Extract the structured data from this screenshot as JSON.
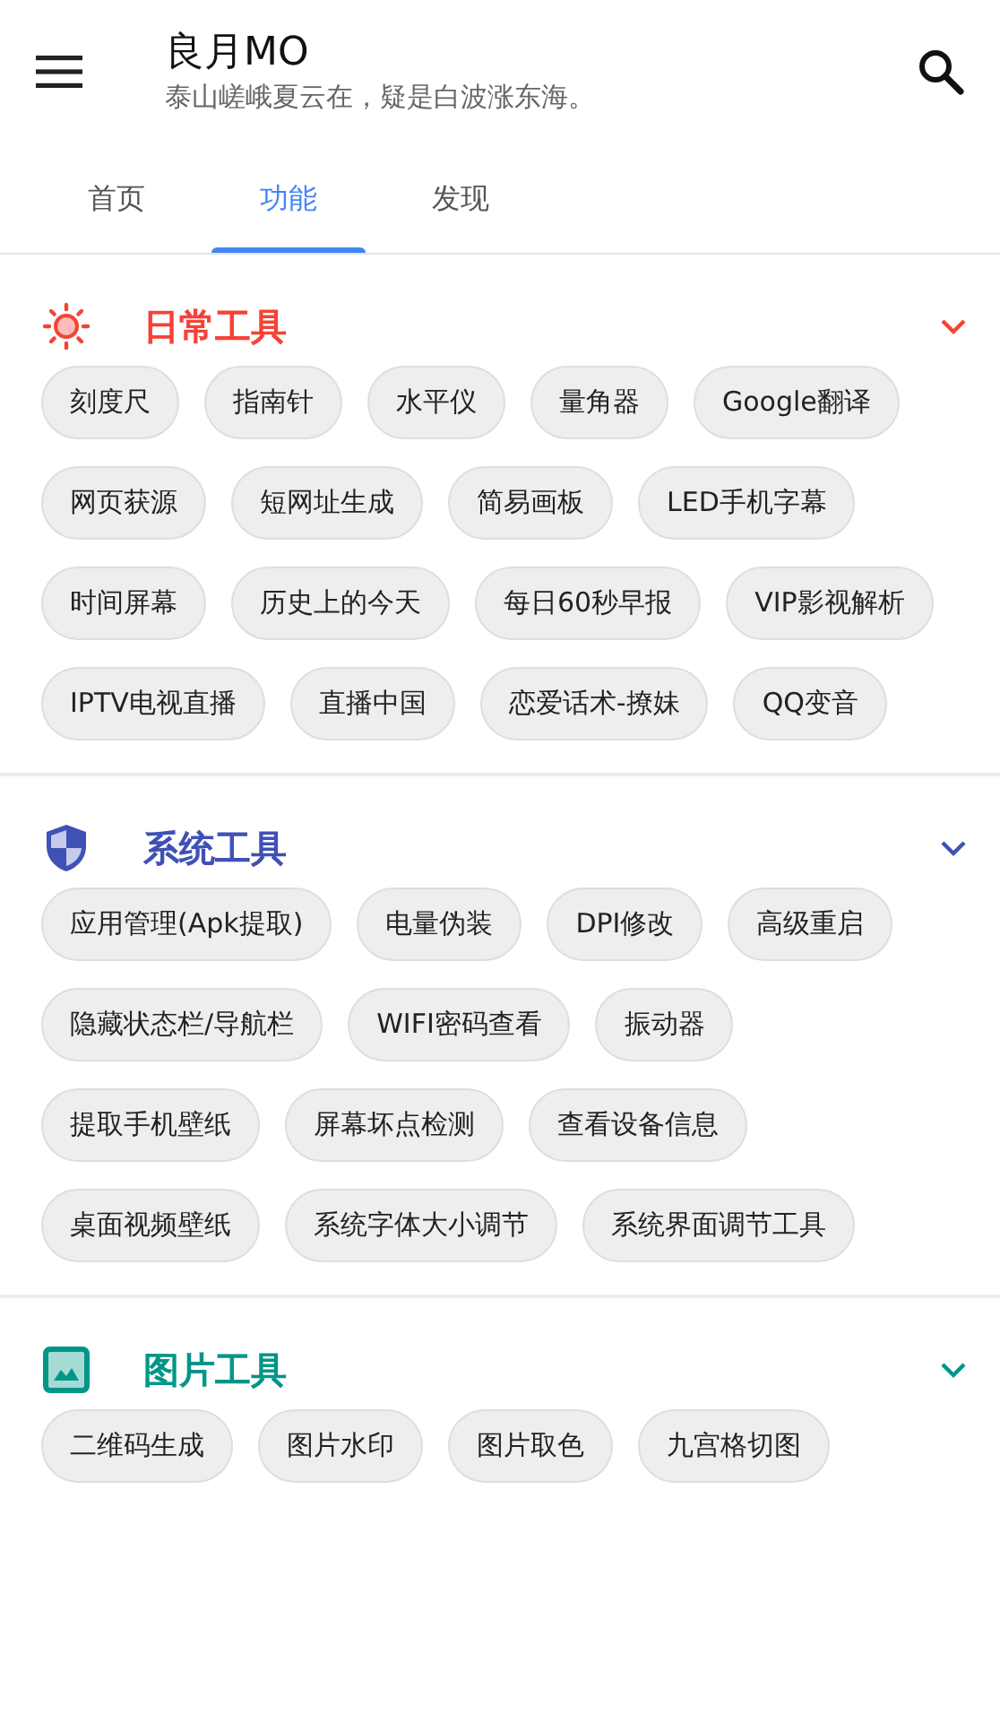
{
  "header": {
    "title": "良月MO",
    "subtitle": "泰山嵯峨夏云在，疑是白波涨东海。"
  },
  "tabs": [
    {
      "label": "首页",
      "selected": false
    },
    {
      "label": "功能",
      "selected": true
    },
    {
      "label": "发现",
      "selected": false
    }
  ],
  "sections": [
    {
      "kind": "sun",
      "title": "日常工具",
      "color": "#f44336",
      "expanded": true,
      "items": [
        "刻度尺",
        "指南针",
        "水平仪",
        "量角器",
        "Google翻译",
        "网页获源",
        "短网址生成",
        "简易画板",
        "LED手机字幕",
        "时间屏幕",
        "历史上的今天",
        "每日60秒早报",
        "VIP影视解析",
        "IPTV电视直播",
        "直播中国",
        "恋爱话术-撩妹",
        "QQ变音"
      ]
    },
    {
      "kind": "shield",
      "title": "系统工具",
      "color": "#3f51b5",
      "expanded": true,
      "items": [
        "应用管理(Apk提取)",
        "电量伪装",
        "DPI修改",
        "高级重启",
        "隐藏状态栏/导航栏",
        "WIFI密码查看",
        "振动器",
        "提取手机壁纸",
        "屏幕坏点检测",
        "查看设备信息",
        "桌面视频壁纸",
        "系统字体大小调节",
        "系统界面调节工具"
      ]
    },
    {
      "kind": "image",
      "title": "图片工具",
      "color": "#009688",
      "expanded": true,
      "items": [
        "二维码生成",
        "图片水印",
        "图片取色",
        "九宫格切图"
      ]
    }
  ]
}
